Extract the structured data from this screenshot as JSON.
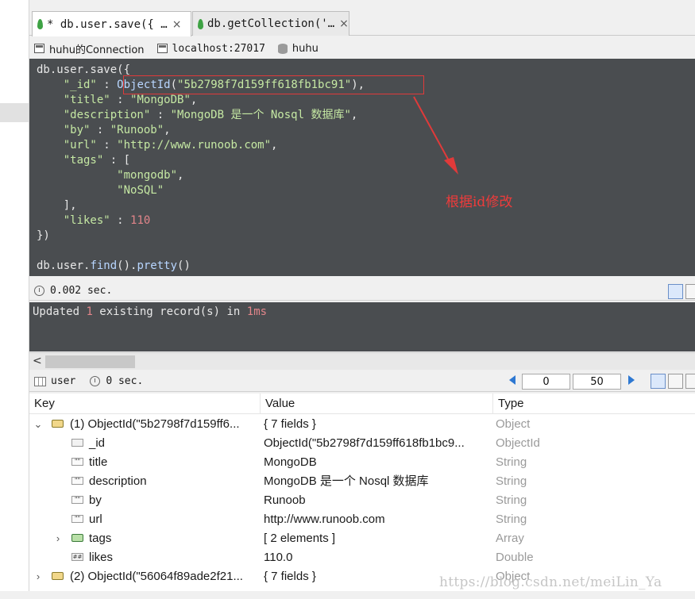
{
  "tabs": [
    {
      "label": "* db.user.save({ …",
      "close": "×"
    },
    {
      "label": "db.getCollection('…",
      "close": "×"
    }
  ],
  "connection": {
    "name": "huhu的Connection",
    "host": "localhost:27017",
    "database": "huhu"
  },
  "editor_lines": [
    "db.user.save({",
    "    \"_id\" : ObjectId(\"5b2798f7d159ff618fb1bc91\"),",
    "    \"title\" : \"MongoDB\",",
    "    \"description\" : \"MongoDB 是一个 Nosql 数据库\",",
    "    \"by\" : \"Runoob\",",
    "    \"url\" : \"http://www.runoob.com\",",
    "    \"tags\" : [",
    "            \"mongodb\",",
    "            \"NoSQL\"",
    "    ],",
    "    \"likes\" : 110",
    "})",
    "",
    "db.user.find().pretty()"
  ],
  "annotation": "根据id修改",
  "exec_time": "0.002 sec.",
  "result_text": "Updated 1 existing record(s) in 1ms",
  "table_toolbar": {
    "collection": "user",
    "time": "0 sec.",
    "page_start": "0",
    "page_size": "50"
  },
  "columns": [
    "Key",
    "Value",
    "Type"
  ],
  "rows": [
    {
      "key": "(1) ObjectId(\"5b2798f7d159ff6...",
      "value": "{ 7 fields }",
      "type": "Object"
    },
    {
      "key": "_id",
      "value": "ObjectId(\"5b2798f7d159ff618fb1bc9...",
      "type": "ObjectId"
    },
    {
      "key": "title",
      "value": "MongoDB",
      "type": "String"
    },
    {
      "key": "description",
      "value": "MongoDB 是一个 Nosql 数据库",
      "type": "String"
    },
    {
      "key": "by",
      "value": "Runoob",
      "type": "String"
    },
    {
      "key": "url",
      "value": "http://www.runoob.com",
      "type": "String"
    },
    {
      "key": "tags",
      "value": "[ 2 elements ]",
      "type": "Array"
    },
    {
      "key": "likes",
      "value": "110.0",
      "type": "Double"
    },
    {
      "key": "(2) ObjectId(\"56064f89ade2f21...",
      "value": "{ 7 fields }",
      "type": "Object"
    }
  ],
  "watermark": "https://blog.csdn.net/meiLin_Ya",
  "colors": {
    "editor_bg": "#4a4d50",
    "string": "#c5e8a3",
    "number": "#e2858a",
    "highlight": "#e03a3a",
    "accent": "#2e78d2"
  }
}
